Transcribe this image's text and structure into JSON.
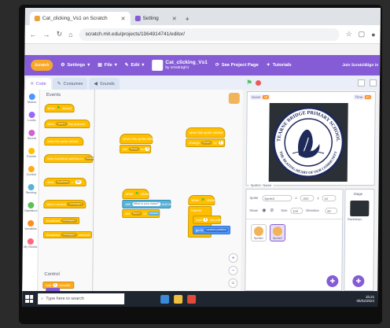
{
  "browser": {
    "tabs": [
      {
        "label": "Cat_clicking_Vs1 on Scratch"
      },
      {
        "label": "Setting"
      }
    ],
    "url": "scratch.mit.edu/projects/1064914741/editor/"
  },
  "menubar": {
    "logo": "Scratch",
    "settings": "Settings",
    "file": "File",
    "edit": "Edit",
    "project_title": "Cat_clicking_Vs1",
    "project_by": "by smsdragh1",
    "see_project_page": "See Project Page",
    "tutorials": "Tutorials",
    "user": "Join Scratch",
    "signin": "Sign in"
  },
  "tabs": {
    "code": "Code",
    "costumes": "Costumes",
    "sounds": "Sounds"
  },
  "categories": [
    {
      "label": "Motion",
      "color": "#4c97ff"
    },
    {
      "label": "Looks",
      "color": "#9966ff"
    },
    {
      "label": "Sound",
      "color": "#cf63cf"
    },
    {
      "label": "Events",
      "color": "#ffbf00"
    },
    {
      "label": "Control",
      "color": "#ffab19"
    },
    {
      "label": "Sensing",
      "color": "#5cb1d6"
    },
    {
      "label": "Operators",
      "color": "#59c059"
    },
    {
      "label": "Variables",
      "color": "#ff8c1a"
    },
    {
      "label": "My Blocks",
      "color": "#ff6680"
    }
  ],
  "palette": {
    "events_heading": "Events",
    "control_heading": "Control",
    "blocks": [
      {
        "text": "when",
        "flag": true,
        "tail": "clicked",
        "hat": true
      },
      {
        "text": "when",
        "pill": "space",
        "tail": "key pressed",
        "hat": true
      },
      {
        "text": "when this sprite clicked",
        "hat": true
      },
      {
        "text": "when backdrop switches to",
        "pill": "backdrop1",
        "hat": true
      },
      {
        "text": "when",
        "pill": "loudness",
        "tail": ">",
        "pill2": "10",
        "hat": true
      },
      {
        "text": "when I receive",
        "pill": "message1",
        "hat": true
      },
      {
        "text": "broadcast",
        "pill": "message1"
      },
      {
        "text": "broadcast",
        "pill": "message1",
        "tail": "and wait"
      },
      {
        "text": "wait",
        "pill": "1",
        "tail": "seconds"
      }
    ]
  },
  "code": {
    "stack1": [
      {
        "text": "when this sprite clicked",
        "type": "event",
        "hat": true
      },
      {
        "text": "set",
        "pill": "Score",
        "tail": "to",
        "pill2": "0",
        "type": "event"
      }
    ],
    "stack2": [
      {
        "text": "when this sprite clicked",
        "type": "event",
        "hat": true
      },
      {
        "text": "change",
        "pill": "Score",
        "tail": "by",
        "pill2": "1",
        "type": "event"
      }
    ],
    "stack3": [
      {
        "text": "when",
        "flag": true,
        "tail": "clicked",
        "type": "event",
        "hat": true
      },
      {
        "text": "ask",
        "pill": "What is your name?",
        "tail": "and wait",
        "type": "sensing"
      },
      {
        "text": "set",
        "pill": "Name",
        "tail": "to",
        "pill2": "answer",
        "type": "event"
      }
    ],
    "stack4": [
      {
        "text": "when",
        "flag": true,
        "tail": "clicked",
        "type": "event",
        "hat": true
      },
      {
        "text": "forever",
        "type": "event"
      },
      {
        "text": "wait",
        "pill": "1",
        "tail": "seconds",
        "type": "event"
      },
      {
        "text": "go to",
        "pill": "random position",
        "type": "motion"
      }
    ]
  },
  "stage": {
    "score_label": "Score",
    "score_value": "38",
    "time_label": "Time",
    "time_value": "20",
    "badge_top": "TEARNE BRIDGE PRIMARY SCHOOL",
    "badge_bottom": "THE BEATING HEART OF OUR COMMUNITY",
    "colors": {
      "navy": "#1e2a5a",
      "ring": "#2c3568"
    }
  },
  "sprite_info": {
    "monitor_label": "Sprite1: Name",
    "sprite_label": "Sprite",
    "sprite_name": "Sprite2",
    "x_label": "x",
    "x_value": "-200",
    "y_label": "y",
    "y_value": "16",
    "show_label": "Show",
    "size_label": "Size",
    "size_value": "100",
    "direction_label": "Direction",
    "direction_value": "90",
    "sprites": [
      {
        "name": "Sprite1"
      },
      {
        "name": "Sprite2"
      }
    ]
  },
  "stage_pane": {
    "label": "Stage",
    "backdrops": "Backdrops"
  },
  "taskbar": {
    "search_placeholder": "Type here to search",
    "time": "15:21",
    "date": "05/02/2024"
  }
}
